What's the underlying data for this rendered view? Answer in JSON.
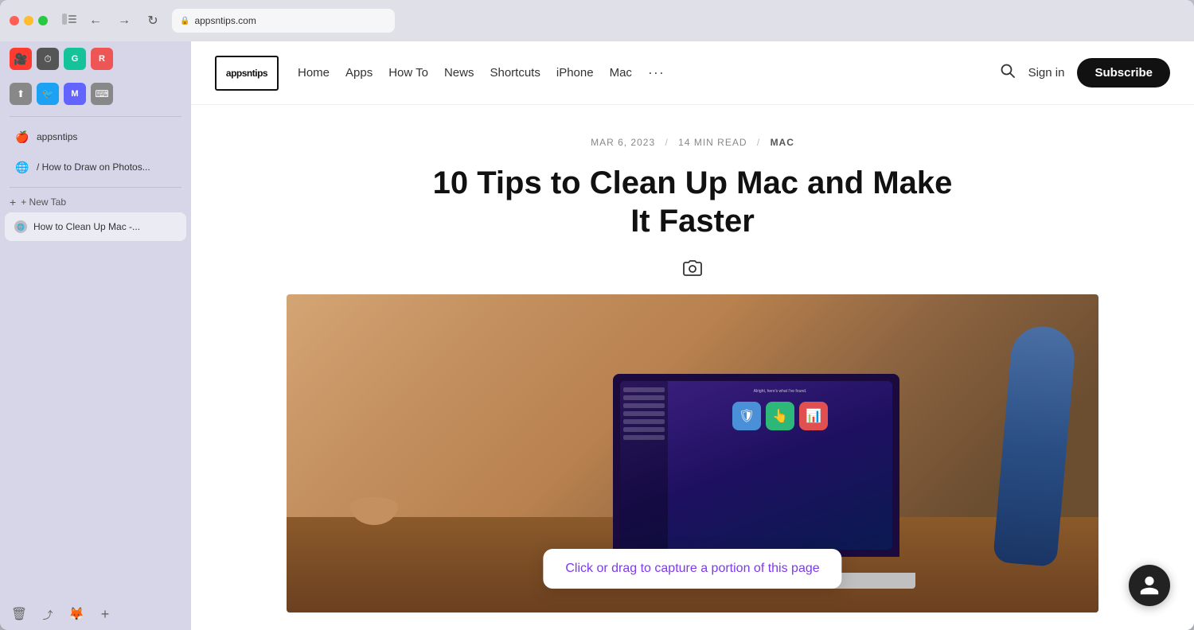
{
  "browser": {
    "address": "appsntips.com",
    "nav_back": "←",
    "nav_forward": "→",
    "nav_refresh": "↻"
  },
  "sidebar": {
    "apps": [
      {
        "icon": "🎥",
        "name": "facetime-icon",
        "bg": "#ff3b30"
      },
      {
        "icon": "⏱",
        "name": "clock-icon",
        "bg": "#555"
      },
      {
        "icon": "G",
        "name": "grammarly-icon",
        "bg": "#15c39a"
      },
      {
        "icon": "R",
        "name": "reeder-icon",
        "bg": "#e55"
      }
    ],
    "bottom_apps": [
      {
        "icon": "⬆",
        "name": "upload-icon",
        "bg": "#888"
      },
      {
        "icon": "🐦",
        "name": "twitter-icon",
        "bg": "#1da1f2"
      },
      {
        "icon": "M",
        "name": "mastodon-icon",
        "bg": "#6364ff"
      },
      {
        "icon": "⌨",
        "name": "keyboard-icon",
        "bg": "#888"
      }
    ],
    "favorites": [
      {
        "icon": "🍎",
        "label": "appsntips",
        "name": "appsntips-bookmark"
      },
      {
        "icon": "🌐",
        "label": "/ How to Draw on Photos...",
        "name": "howto-bookmark"
      }
    ],
    "new_tab_label": "+ New Tab",
    "active_tab_label": "How to Clean Up Mac -...",
    "trash_label": "🗑",
    "share_label": "⤴",
    "firefox_label": "🦊",
    "add_label": "+"
  },
  "site": {
    "logo_text": "appsntips",
    "nav_links": [
      {
        "label": "Home",
        "name": "home-nav-link"
      },
      {
        "label": "Apps",
        "name": "apps-nav-link"
      },
      {
        "label": "How To",
        "name": "howto-nav-link"
      },
      {
        "label": "News",
        "name": "news-nav-link"
      },
      {
        "label": "Shortcuts",
        "name": "shortcuts-nav-link"
      },
      {
        "label": "iPhone",
        "name": "iphone-nav-link"
      },
      {
        "label": "Mac",
        "name": "mac-nav-link"
      }
    ],
    "more_label": "···",
    "search_label": "Search",
    "sign_in_label": "Sign in",
    "subscribe_label": "Subscribe"
  },
  "article": {
    "date": "MAR 6, 2023",
    "read_time": "14 MIN READ",
    "category": "MAC",
    "title_line1": "10 Tips to Clean Up Mac and Make It",
    "title_line2": "Faster",
    "title_full": "10 Tips to Clean Up Mac and Make It Faster"
  },
  "capture_tooltip": {
    "text": "Click or drag to capture a portion of this page"
  },
  "colors": {
    "subscribe_bg": "#111111",
    "tooltip_text": "#7c3aed",
    "article_title": "#111111"
  }
}
